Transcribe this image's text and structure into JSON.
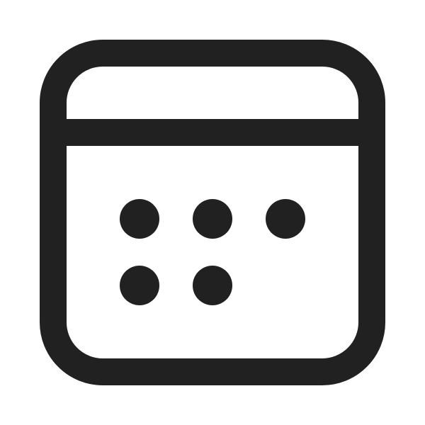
{
  "icon": {
    "name": "calendar-icon",
    "stroke_color": "#212121",
    "background_color": "#ffffff",
    "date_dots": {
      "rows": [
        3,
        2
      ]
    }
  }
}
